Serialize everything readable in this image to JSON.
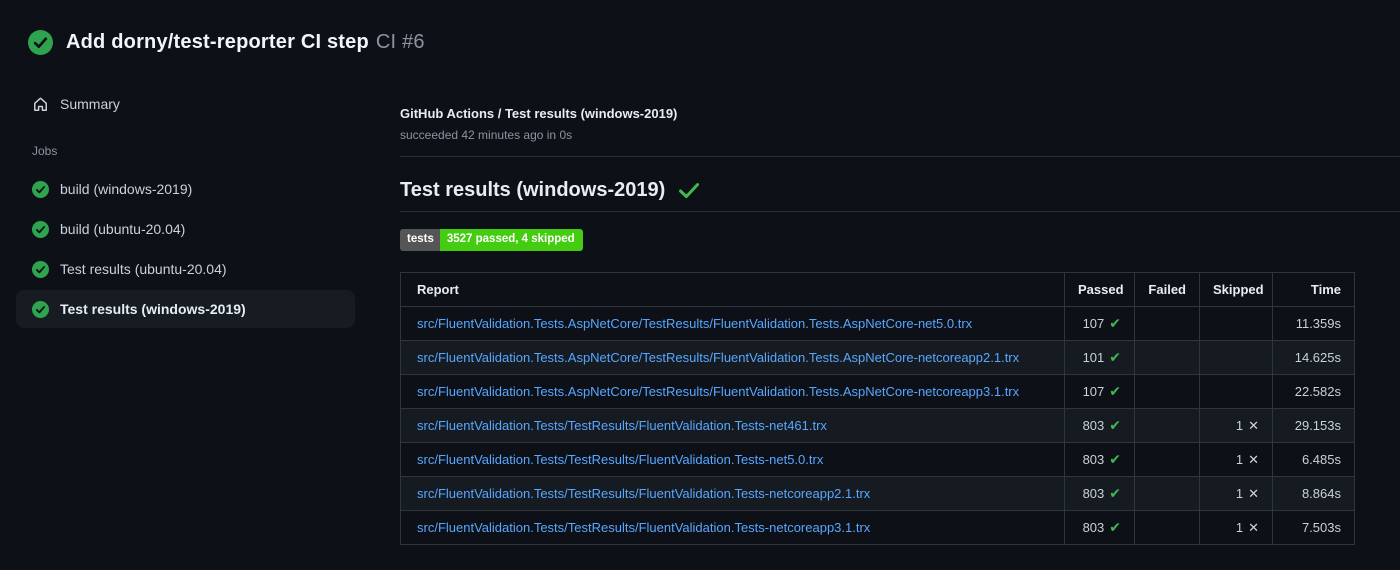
{
  "run_header": {
    "title": "Add dorny/test-reporter CI step",
    "run_number": "CI #6"
  },
  "sidebar": {
    "summary_label": "Summary",
    "jobs_label": "Jobs",
    "jobs": [
      {
        "label": "build (windows-2019)",
        "status": "success",
        "selected": false
      },
      {
        "label": "build (ubuntu-20.04)",
        "status": "success",
        "selected": false
      },
      {
        "label": "Test results (ubuntu-20.04)",
        "status": "success",
        "selected": false
      },
      {
        "label": "Test results (windows-2019)",
        "status": "success",
        "selected": true
      }
    ]
  },
  "main": {
    "breadcrumb": "GitHub Actions / Test results (windows-2019)",
    "status_line": "succeeded 42 minutes ago in 0s",
    "section_title": "Test results (windows-2019)",
    "badge": {
      "label": "tests",
      "value": "3527 passed, 4 skipped",
      "label_bg": "#555555",
      "value_bg": "#44cc11"
    },
    "table": {
      "columns": [
        "Report",
        "Passed",
        "Failed",
        "Skipped",
        "Time"
      ],
      "rows": [
        {
          "report": "src/FluentValidation.Tests.AspNetCore/TestResults/FluentValidation.Tests.AspNetCore-net5.0.trx",
          "passed": "107",
          "failed": "",
          "skipped": "",
          "time": "11.359s"
        },
        {
          "report": "src/FluentValidation.Tests.AspNetCore/TestResults/FluentValidation.Tests.AspNetCore-netcoreapp2.1.trx",
          "passed": "101",
          "failed": "",
          "skipped": "",
          "time": "14.625s"
        },
        {
          "report": "src/FluentValidation.Tests.AspNetCore/TestResults/FluentValidation.Tests.AspNetCore-netcoreapp3.1.trx",
          "passed": "107",
          "failed": "",
          "skipped": "",
          "time": "22.582s"
        },
        {
          "report": "src/FluentValidation.Tests/TestResults/FluentValidation.Tests-net461.trx",
          "passed": "803",
          "failed": "",
          "skipped": "1",
          "time": "29.153s"
        },
        {
          "report": "src/FluentValidation.Tests/TestResults/FluentValidation.Tests-net5.0.trx",
          "passed": "803",
          "failed": "",
          "skipped": "1",
          "time": "6.485s"
        },
        {
          "report": "src/FluentValidation.Tests/TestResults/FluentValidation.Tests-netcoreapp2.1.trx",
          "passed": "803",
          "failed": "",
          "skipped": "1",
          "time": "8.864s"
        },
        {
          "report": "src/FluentValidation.Tests/TestResults/FluentValidation.Tests-netcoreapp3.1.trx",
          "passed": "803",
          "failed": "",
          "skipped": "1",
          "time": "7.503s"
        }
      ]
    }
  },
  "icons": {
    "run_status": "check-circle",
    "summary": "home",
    "job_status": "check-circle",
    "heading_status": "check",
    "passed_glyph": "✔",
    "skipped_glyph": "✕"
  },
  "colors": {
    "page_bg": "#0d1117",
    "success_circle": "#2ea44f",
    "success_check": "#3fb950",
    "skipped_x": "#ced4da",
    "link": "#58a6ff",
    "border": "#30363d",
    "row_alt_bg": "#161b22",
    "selected_item_bg": "#171c23"
  }
}
